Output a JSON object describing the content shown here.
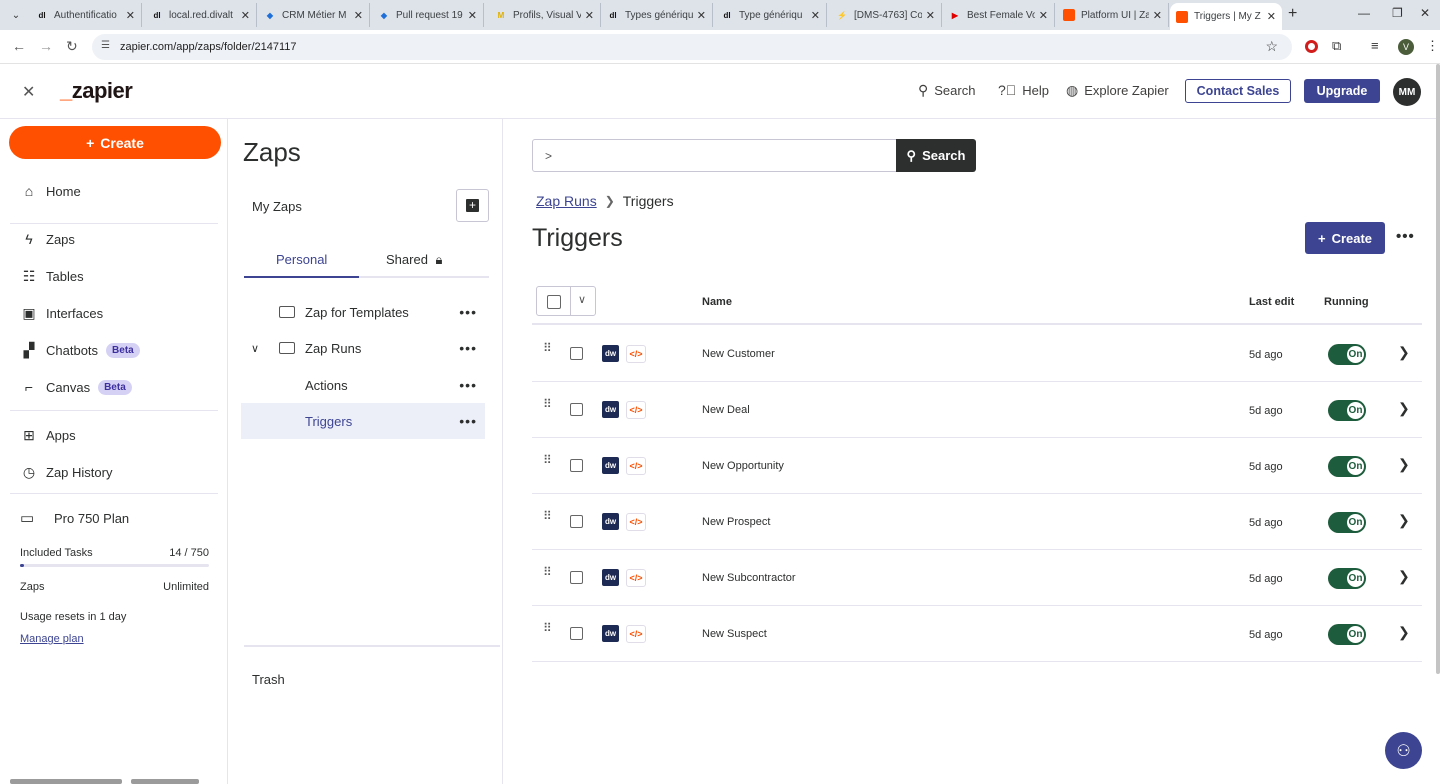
{
  "browser": {
    "tabs": [
      {
        "title": "Authentificatio",
        "fav": "dl",
        "color": "#111111"
      },
      {
        "title": "local.red.divalt",
        "fav": "dl",
        "color": "#111111"
      },
      {
        "title": "CRM Métier M",
        "fav": "◆",
        "color": "#1e6fd9"
      },
      {
        "title": "Pull request 19",
        "fav": "◆",
        "color": "#1e6fd9"
      },
      {
        "title": "Profils, Visual V",
        "fav": "M",
        "color": "#e0b000"
      },
      {
        "title": "Types génériqu",
        "fav": "dl",
        "color": "#111111"
      },
      {
        "title": "Type génériqu",
        "fav": "dl",
        "color": "#111111"
      },
      {
        "title": "[DMS-4763] Co",
        "fav": "⚡",
        "color": "#2e7bf6"
      },
      {
        "title": "Best Female Vo",
        "fav": "▶",
        "color": "#e00000"
      },
      {
        "title": "Platform UI | Za",
        "fav": "",
        "color": "#ff4f00"
      },
      {
        "title": "Triggers | My Z",
        "fav": "",
        "color": "#ff4f00"
      }
    ],
    "url": "zapier.com/app/zaps/folder/2147117",
    "profile_initial": "V"
  },
  "header": {
    "logo_prefix": "_",
    "logo_text": "zapier",
    "search_label": "Search",
    "help_label": "Help",
    "explore_label": "Explore Zapier",
    "contact_label": "Contact Sales",
    "upgrade_label": "Upgrade",
    "avatar_initials": "MM"
  },
  "sidebar": {
    "create_label": "Create",
    "items": [
      {
        "label": "Home",
        "icon": "home-icon",
        "glyph": "⌂"
      },
      {
        "label": "Zaps",
        "icon": "bolt-icon",
        "glyph": "ϟ"
      },
      {
        "label": "Tables",
        "icon": "tables-icon",
        "glyph": "☷"
      },
      {
        "label": "Interfaces",
        "icon": "interfaces-icon",
        "glyph": "▣"
      },
      {
        "label": "Chatbots",
        "icon": "chatbots-icon",
        "glyph": "▞",
        "badge": "Beta"
      },
      {
        "label": "Canvas",
        "icon": "canvas-icon",
        "glyph": "⌐",
        "badge": "Beta"
      },
      {
        "label": "Apps",
        "icon": "apps-icon",
        "glyph": "⊞"
      },
      {
        "label": "Zap History",
        "icon": "history-icon",
        "glyph": "◷"
      }
    ],
    "plan": {
      "name": "Pro 750 Plan",
      "tasks_label": "Included Tasks",
      "tasks_value": "14 / 750",
      "tasks_fraction": 0.0187,
      "zaps_label": "Zaps",
      "zaps_value": "Unlimited",
      "reset_text": "Usage resets in 1 day",
      "manage_label": "Manage plan"
    }
  },
  "folders": {
    "title": "Zaps",
    "section_label": "My Zaps",
    "tabs": {
      "personal": "Personal",
      "shared": "Shared"
    },
    "items": [
      {
        "label": "Zap for Templates",
        "level": 0,
        "folder": true
      },
      {
        "label": "Zap Runs",
        "level": 0,
        "folder": true,
        "expanded": true
      },
      {
        "label": "Actions",
        "level": 1,
        "folder": false
      },
      {
        "label": "Triggers",
        "level": 1,
        "folder": false,
        "selected": true
      }
    ],
    "trash_label": "Trash"
  },
  "main": {
    "search_value": "",
    "search_button": "Search",
    "breadcrumb": {
      "parent": "Zap Runs",
      "current": "Triggers"
    },
    "title": "Triggers",
    "create_label": "Create",
    "columns": {
      "name": "Name",
      "last_edit": "Last edit",
      "running": "Running"
    },
    "rows": [
      {
        "name": "New Customer",
        "last_edit": "5d ago",
        "status": "On",
        "app1": "dw",
        "app2": "</>"
      },
      {
        "name": "New Deal",
        "last_edit": "5d ago",
        "status": "On",
        "app1": "dw",
        "app2": "</>"
      },
      {
        "name": "New Opportunity",
        "last_edit": "5d ago",
        "status": "On",
        "app1": "dw",
        "app2": "</>"
      },
      {
        "name": "New Prospect",
        "last_edit": "5d ago",
        "status": "On",
        "app1": "dw",
        "app2": "</>"
      },
      {
        "name": "New Subcontractor",
        "last_edit": "5d ago",
        "status": "On",
        "app1": "dw",
        "app2": "</>"
      },
      {
        "name": "New Suspect",
        "last_edit": "5d ago",
        "status": "On",
        "app1": "dw",
        "app2": "</>"
      }
    ]
  },
  "colors": {
    "brand_orange": "#ff4f00",
    "primary": "#3d4592",
    "toggle_on": "#1d5c3c"
  }
}
